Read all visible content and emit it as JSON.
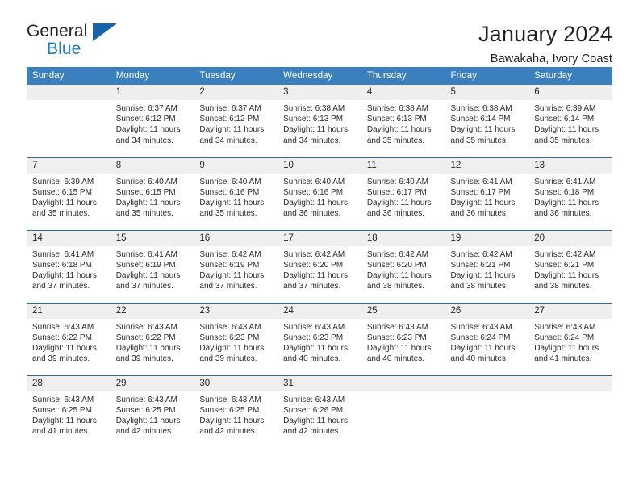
{
  "brand": {
    "name_top": "General",
    "name_bottom": "Blue",
    "flag_color": "#1565a8"
  },
  "header": {
    "title": "January 2024",
    "subtitle": "Bawakaha, Ivory Coast"
  },
  "theme": {
    "header_bg": "#3a7fbe",
    "daynum_bg": "#efefef",
    "week_divider": "#2e6da4"
  },
  "weekdays": [
    "Sunday",
    "Monday",
    "Tuesday",
    "Wednesday",
    "Thursday",
    "Friday",
    "Saturday"
  ],
  "weeks": [
    [
      {
        "day": "",
        "lines": []
      },
      {
        "day": "1",
        "lines": [
          "Sunrise: 6:37 AM",
          "Sunset: 6:12 PM",
          "Daylight: 11 hours",
          "and 34 minutes."
        ]
      },
      {
        "day": "2",
        "lines": [
          "Sunrise: 6:37 AM",
          "Sunset: 6:12 PM",
          "Daylight: 11 hours",
          "and 34 minutes."
        ]
      },
      {
        "day": "3",
        "lines": [
          "Sunrise: 6:38 AM",
          "Sunset: 6:13 PM",
          "Daylight: 11 hours",
          "and 34 minutes."
        ]
      },
      {
        "day": "4",
        "lines": [
          "Sunrise: 6:38 AM",
          "Sunset: 6:13 PM",
          "Daylight: 11 hours",
          "and 35 minutes."
        ]
      },
      {
        "day": "5",
        "lines": [
          "Sunrise: 6:38 AM",
          "Sunset: 6:14 PM",
          "Daylight: 11 hours",
          "and 35 minutes."
        ]
      },
      {
        "day": "6",
        "lines": [
          "Sunrise: 6:39 AM",
          "Sunset: 6:14 PM",
          "Daylight: 11 hours",
          "and 35 minutes."
        ]
      }
    ],
    [
      {
        "day": "7",
        "lines": [
          "Sunrise: 6:39 AM",
          "Sunset: 6:15 PM",
          "Daylight: 11 hours",
          "and 35 minutes."
        ]
      },
      {
        "day": "8",
        "lines": [
          "Sunrise: 6:40 AM",
          "Sunset: 6:15 PM",
          "Daylight: 11 hours",
          "and 35 minutes."
        ]
      },
      {
        "day": "9",
        "lines": [
          "Sunrise: 6:40 AM",
          "Sunset: 6:16 PM",
          "Daylight: 11 hours",
          "and 35 minutes."
        ]
      },
      {
        "day": "10",
        "lines": [
          "Sunrise: 6:40 AM",
          "Sunset: 6:16 PM",
          "Daylight: 11 hours",
          "and 36 minutes."
        ]
      },
      {
        "day": "11",
        "lines": [
          "Sunrise: 6:40 AM",
          "Sunset: 6:17 PM",
          "Daylight: 11 hours",
          "and 36 minutes."
        ]
      },
      {
        "day": "12",
        "lines": [
          "Sunrise: 6:41 AM",
          "Sunset: 6:17 PM",
          "Daylight: 11 hours",
          "and 36 minutes."
        ]
      },
      {
        "day": "13",
        "lines": [
          "Sunrise: 6:41 AM",
          "Sunset: 6:18 PM",
          "Daylight: 11 hours",
          "and 36 minutes."
        ]
      }
    ],
    [
      {
        "day": "14",
        "lines": [
          "Sunrise: 6:41 AM",
          "Sunset: 6:18 PM",
          "Daylight: 11 hours",
          "and 37 minutes."
        ]
      },
      {
        "day": "15",
        "lines": [
          "Sunrise: 6:41 AM",
          "Sunset: 6:19 PM",
          "Daylight: 11 hours",
          "and 37 minutes."
        ]
      },
      {
        "day": "16",
        "lines": [
          "Sunrise: 6:42 AM",
          "Sunset: 6:19 PM",
          "Daylight: 11 hours",
          "and 37 minutes."
        ]
      },
      {
        "day": "17",
        "lines": [
          "Sunrise: 6:42 AM",
          "Sunset: 6:20 PM",
          "Daylight: 11 hours",
          "and 37 minutes."
        ]
      },
      {
        "day": "18",
        "lines": [
          "Sunrise: 6:42 AM",
          "Sunset: 6:20 PM",
          "Daylight: 11 hours",
          "and 38 minutes."
        ]
      },
      {
        "day": "19",
        "lines": [
          "Sunrise: 6:42 AM",
          "Sunset: 6:21 PM",
          "Daylight: 11 hours",
          "and 38 minutes."
        ]
      },
      {
        "day": "20",
        "lines": [
          "Sunrise: 6:42 AM",
          "Sunset: 6:21 PM",
          "Daylight: 11 hours",
          "and 38 minutes."
        ]
      }
    ],
    [
      {
        "day": "21",
        "lines": [
          "Sunrise: 6:43 AM",
          "Sunset: 6:22 PM",
          "Daylight: 11 hours",
          "and 39 minutes."
        ]
      },
      {
        "day": "22",
        "lines": [
          "Sunrise: 6:43 AM",
          "Sunset: 6:22 PM",
          "Daylight: 11 hours",
          "and 39 minutes."
        ]
      },
      {
        "day": "23",
        "lines": [
          "Sunrise: 6:43 AM",
          "Sunset: 6:23 PM",
          "Daylight: 11 hours",
          "and 39 minutes."
        ]
      },
      {
        "day": "24",
        "lines": [
          "Sunrise: 6:43 AM",
          "Sunset: 6:23 PM",
          "Daylight: 11 hours",
          "and 40 minutes."
        ]
      },
      {
        "day": "25",
        "lines": [
          "Sunrise: 6:43 AM",
          "Sunset: 6:23 PM",
          "Daylight: 11 hours",
          "and 40 minutes."
        ]
      },
      {
        "day": "26",
        "lines": [
          "Sunrise: 6:43 AM",
          "Sunset: 6:24 PM",
          "Daylight: 11 hours",
          "and 40 minutes."
        ]
      },
      {
        "day": "27",
        "lines": [
          "Sunrise: 6:43 AM",
          "Sunset: 6:24 PM",
          "Daylight: 11 hours",
          "and 41 minutes."
        ]
      }
    ],
    [
      {
        "day": "28",
        "lines": [
          "Sunrise: 6:43 AM",
          "Sunset: 6:25 PM",
          "Daylight: 11 hours",
          "and 41 minutes."
        ]
      },
      {
        "day": "29",
        "lines": [
          "Sunrise: 6:43 AM",
          "Sunset: 6:25 PM",
          "Daylight: 11 hours",
          "and 42 minutes."
        ]
      },
      {
        "day": "30",
        "lines": [
          "Sunrise: 6:43 AM",
          "Sunset: 6:25 PM",
          "Daylight: 11 hours",
          "and 42 minutes."
        ]
      },
      {
        "day": "31",
        "lines": [
          "Sunrise: 6:43 AM",
          "Sunset: 6:26 PM",
          "Daylight: 11 hours",
          "and 42 minutes."
        ]
      },
      {
        "day": "",
        "lines": []
      },
      {
        "day": "",
        "lines": []
      },
      {
        "day": "",
        "lines": []
      }
    ]
  ]
}
